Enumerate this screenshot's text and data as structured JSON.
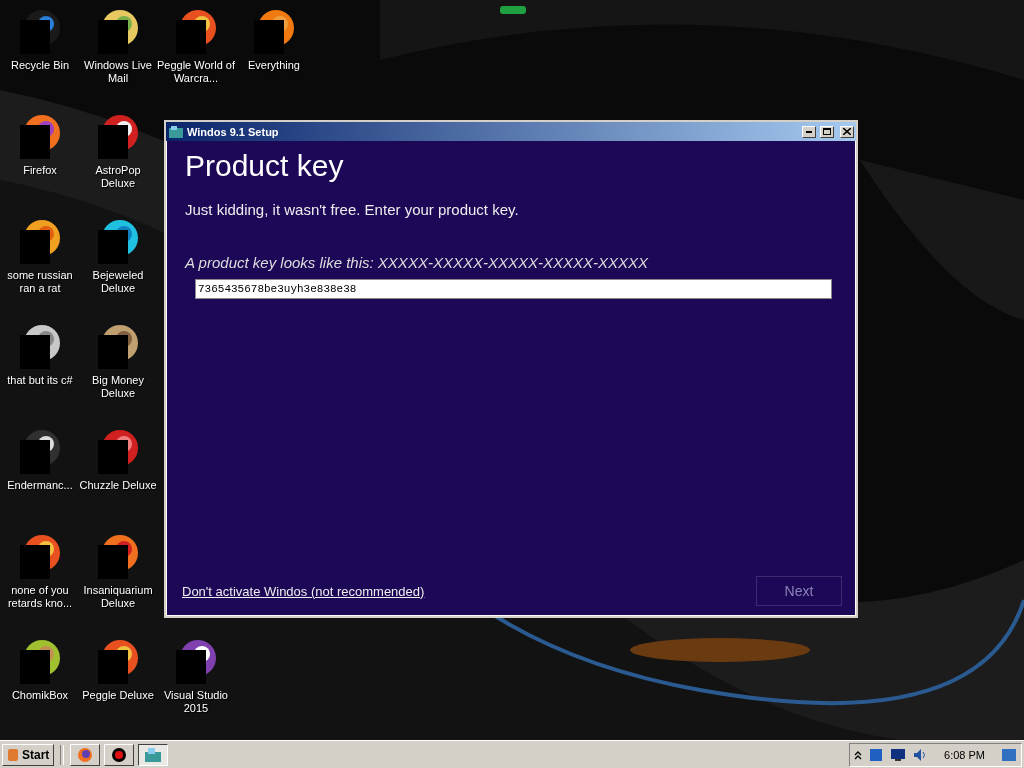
{
  "desktop": {
    "icons": [
      {
        "label": "Recycle Bin",
        "kind": "bin"
      },
      {
        "label": "Windows Live Mail",
        "kind": "folders"
      },
      {
        "label": "Peggle World of Warcra...",
        "kind": "swirl"
      },
      {
        "label": "Everything",
        "kind": "ring"
      },
      {
        "label": "Firefox",
        "kind": "fox"
      },
      {
        "label": "AstroPop Deluxe",
        "kind": "blocks"
      },
      {
        "label": "some russian ran a rat",
        "kind": "tile"
      },
      {
        "label": "Bejeweled Deluxe",
        "kind": "gem"
      },
      {
        "label": "that but its c#",
        "kind": "windows"
      },
      {
        "label": "Big Money Deluxe",
        "kind": "bag"
      },
      {
        "label": "Endermanc...",
        "kind": "console"
      },
      {
        "label": "Chuzzle Deluxe",
        "kind": "fluff"
      },
      {
        "label": "none of you retards kno...",
        "kind": "swirl"
      },
      {
        "label": "Insaniquarium Deluxe",
        "kind": "fish"
      },
      {
        "label": "ChomikBox",
        "kind": "hamster"
      },
      {
        "label": "Peggle Deluxe",
        "kind": "swirl"
      },
      {
        "label": "Visual Studio 2015",
        "kind": "studio"
      }
    ]
  },
  "window": {
    "title": "Windos 9.1 Setup",
    "heading": "Product key",
    "intro": "Just kidding, it wasn't free.  Enter your product key.",
    "hint": "A product key looks like this: XXXXX-XXXXX-XXXXX-XXXXX-XXXXX",
    "product_key": {
      "value": "7365435678be3uyh3e838e38"
    },
    "skip_link": "Don't activate Windos (not recommended)",
    "next_button": {
      "label": "Next",
      "disabled": true
    }
  },
  "taskbar": {
    "start": "Start",
    "tasks": [
      {
        "kind": "browser",
        "selected": false
      },
      {
        "kind": "record",
        "selected": false
      },
      {
        "kind": "setup",
        "selected": true
      }
    ],
    "clock": "6:08 PM"
  }
}
